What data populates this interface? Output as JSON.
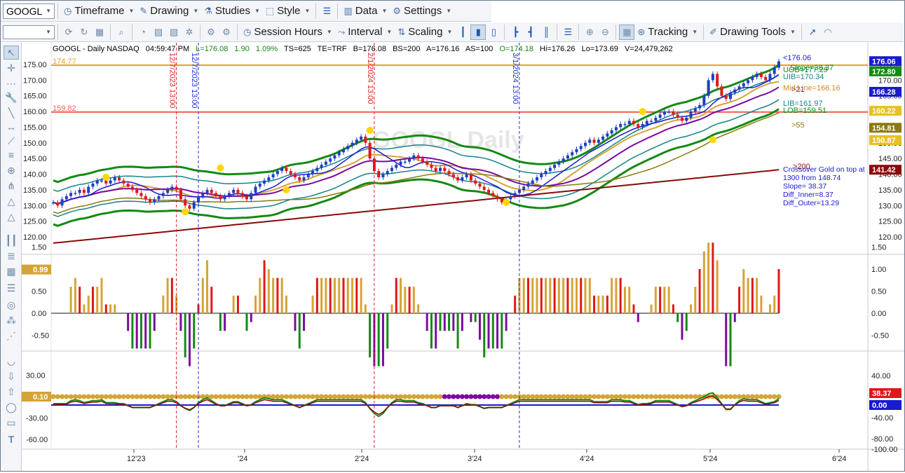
{
  "toolbar1": {
    "symbol": "GOOGL",
    "timeframe": "Timeframe",
    "drawing": "Drawing",
    "studies": "Studies",
    "style": "Style",
    "data": "Data",
    "settings": "Settings"
  },
  "toolbar2": {
    "session_hours": "Session Hours",
    "interval": "Interval",
    "scaling": "Scaling",
    "tracking": "Tracking",
    "drawing_tools": "Drawing Tools"
  },
  "header": {
    "symbol_info": "GOOGL - Daily  NASDAQ",
    "time": "04:59:47 PM",
    "last": "L=176.08",
    "change": "1.90",
    "change_pct": "1.09%",
    "ts": "TS=625",
    "te": "TE=TRF",
    "bid": "B=176.08",
    "bs": "BS=200",
    "ask": "A=176.16",
    "as": "AS=100",
    "open": "O=174.18",
    "hi": "Hi=176.26",
    "lo": "Lo=173.69",
    "vol": "V=24,479,262"
  },
  "watermark": "GOOGL Daily",
  "colors": {
    "up": "#1f3fbf",
    "down": "#e01818",
    "ma_green": "#138a13",
    "teal": "#16838a",
    "orange_line": "#f0a020",
    "red_line": "#f06050",
    "purple": "#7a0aa0",
    "blue": "#1a1ad0",
    "darkred": "#8a0a0a",
    "gold": "#d4a437",
    "yellow_dot": "#ffd700"
  },
  "h_lines": [
    {
      "label": "174.77",
      "price": 174.77,
      "color": "#f0a020"
    },
    {
      "label": "159.82",
      "price": 159.82,
      "color": "#f06050"
    }
  ],
  "v_lines": [
    {
      "label": "12/7/2023 13:00",
      "date_index": 28,
      "color": "#e02020"
    },
    {
      "label": "12/7/2023 13:00",
      "date_index": 33,
      "color": "#2030d0"
    },
    {
      "label": "2/1/2024 13:00",
      "date_index": 73,
      "color": "#e02020"
    },
    {
      "label": "3/1/2024 13:00",
      "date_index": 106,
      "color": "#2030d0"
    }
  ],
  "annotations": [
    {
      "text": "<176.06",
      "color": "#1a1ad0"
    },
    {
      "text": "Slope=38.37",
      "color": "#138a13"
    },
    {
      "text": "UOB=177.29",
      "color": "#138a13"
    },
    {
      "text": "UIB=170.34",
      "color": "#16838a"
    },
    {
      "text": ">21",
      "color": "#7a0aa0"
    },
    {
      "text": "Mid Line=166.16",
      "color": "#d48a20"
    },
    {
      "text": "LIB=161.97",
      "color": "#16838a"
    },
    {
      "text": "LOB=159.51",
      "color": "#138a13"
    },
    {
      "text": ">55",
      "color": "#8a7a10"
    },
    {
      "text": ">200",
      "color": "#8a0a0a"
    }
  ],
  "info_box": [
    "Crossover Gold on top at",
    "1300 from 148.74",
    "Slope= 38.37",
    "Diff_Inner=8.37",
    "Diff_Outer=13.29"
  ],
  "price_axis": {
    "ticks": [
      "175.00",
      "170.00",
      "165.00",
      "160.00",
      "155.00",
      "150.00",
      "145.00",
      "140.00",
      "135.00",
      "130.00",
      "125.00",
      "120.00"
    ],
    "left_ticks": [
      "175.00",
      "170.00",
      "165.00",
      "160.00",
      "155.00",
      "150.00",
      "145.00",
      "140.00",
      "135.00",
      "130.00",
      "125.00",
      "120.00"
    ],
    "badges": [
      {
        "text": "176.06",
        "bg": "#1a1ad0",
        "price": 176.06
      },
      {
        "text": "172.80",
        "bg": "#138a13",
        "price": 172.8
      },
      {
        "text": "166.28",
        "bg": "#1a1ad0",
        "price": 166.28
      },
      {
        "text": "160.22",
        "bg": "#e8c020",
        "price": 160.22
      },
      {
        "text": "154.81",
        "bg": "#8a7a10",
        "price": 154.81
      },
      {
        "text": "150.87",
        "bg": "#e8c020",
        "price": 150.87
      },
      {
        "text": "141.42",
        "bg": "#8a0a0a",
        "price": 141.42
      }
    ]
  },
  "osc1_axis": {
    "left_ticks": [
      "1.50",
      "1.00",
      "0.50",
      "0.00",
      "-0.50"
    ],
    "right_ticks": [
      "1.50",
      "1.00",
      "0.50",
      "0.00",
      "-0.50"
    ],
    "badge": "0.99"
  },
  "osc2_axis": {
    "left_ticks": [
      "30.00",
      "-30.00",
      "-60.00"
    ],
    "right_ticks": [
      "40.00",
      "-40.00",
      "-80.00",
      "-100.00"
    ],
    "badge_left": "0.10",
    "badge_right_1": "38.37",
    "badge_right_2": "0.00"
  },
  "time_axis": [
    "12'23",
    "'24",
    "2'24",
    "3'24",
    "4'24",
    "5'24",
    "6'24"
  ],
  "chart_data": {
    "type": "candlestick",
    "series": [
      {
        "name": "GOOGL",
        "close": [
          131,
          130,
          132,
          133,
          134,
          134,
          135,
          134,
          136,
          137,
          138,
          138,
          137,
          138,
          139,
          138,
          137,
          136,
          135,
          134,
          133,
          132,
          131,
          132,
          133,
          134,
          135,
          136,
          135,
          132,
          130,
          129,
          131,
          133,
          134,
          135,
          134,
          133,
          132,
          133,
          134,
          135,
          134,
          133,
          132,
          134,
          136,
          137,
          138,
          139,
          140,
          141,
          142,
          141,
          140,
          139,
          138,
          139,
          140,
          141,
          142,
          143,
          144,
          145,
          146,
          147,
          148,
          149,
          150,
          151,
          152,
          150,
          145,
          141,
          139,
          140,
          141,
          142,
          143,
          144,
          144,
          145,
          146,
          145,
          144,
          143,
          142,
          141,
          142,
          141,
          140,
          139,
          138,
          139,
          140,
          138,
          137,
          136,
          135,
          134,
          133,
          132,
          131,
          132,
          133,
          134,
          135,
          136,
          137,
          138,
          139,
          140,
          141,
          142,
          143,
          144,
          145,
          146,
          147,
          148,
          149,
          150,
          151,
          150,
          151,
          152,
          153,
          154,
          155,
          156,
          156,
          157,
          156,
          155,
          156,
          157,
          157,
          158,
          159,
          160,
          160,
          159,
          158,
          157,
          158,
          160,
          161,
          162,
          165,
          170,
          172,
          168,
          165,
          164,
          166,
          167,
          168,
          169,
          170,
          171,
          172,
          171,
          170,
          172,
          174,
          176
        ]
      }
    ]
  }
}
